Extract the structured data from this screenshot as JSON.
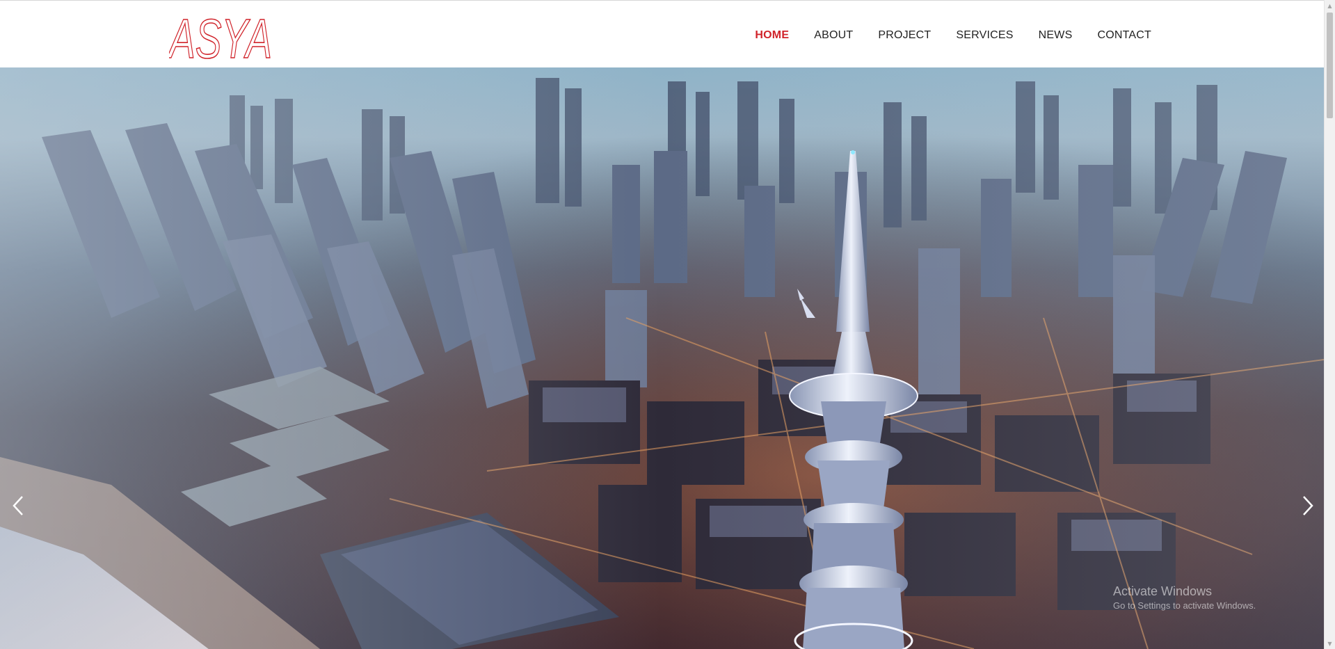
{
  "brand": {
    "logo_text": "ASYA",
    "logo_color": "#d0232a"
  },
  "nav": {
    "items": [
      {
        "label": "HOME",
        "active": true
      },
      {
        "label": "ABOUT",
        "active": false
      },
      {
        "label": "PROJECT",
        "active": false
      },
      {
        "label": "SERVICES",
        "active": false
      },
      {
        "label": "NEWS",
        "active": false
      },
      {
        "label": "CONTACT",
        "active": false
      }
    ],
    "active_color": "#d0232a",
    "text_color": "#222222"
  },
  "hero": {
    "image_subject": "aerial city skyline at dusk with spiral tower",
    "prev_icon": "chevron-left-icon",
    "next_icon": "chevron-right-icon"
  },
  "watermark": {
    "title": "Activate Windows",
    "subtitle": "Go to Settings to activate Windows."
  }
}
